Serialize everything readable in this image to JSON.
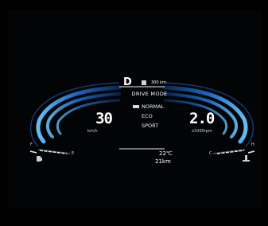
{
  "gear": "D",
  "range_value": "300 km",
  "drive_mode": {
    "title": "DRIVE MODE",
    "options": [
      "NORMAL",
      "ECO",
      "SPORT"
    ],
    "selected": "NORMAL"
  },
  "speed": {
    "value": "30",
    "unit": "km/h"
  },
  "rpm": {
    "value": "2.0",
    "unit": "x1000rpm"
  },
  "fuel": {
    "empty_label": "E",
    "full_label": "F"
  },
  "temperature_gauge": {
    "cold_label": "C",
    "hot_label": "H"
  },
  "outside_temp": "22℃",
  "trip_distance": "21km",
  "colors": {
    "accent": "#2a8fe0",
    "background": "#030406"
  },
  "icons": [
    "fuel-pump-icon",
    "coolant-thermometer-icon",
    "range-icon",
    "mode-selected-icon"
  ]
}
